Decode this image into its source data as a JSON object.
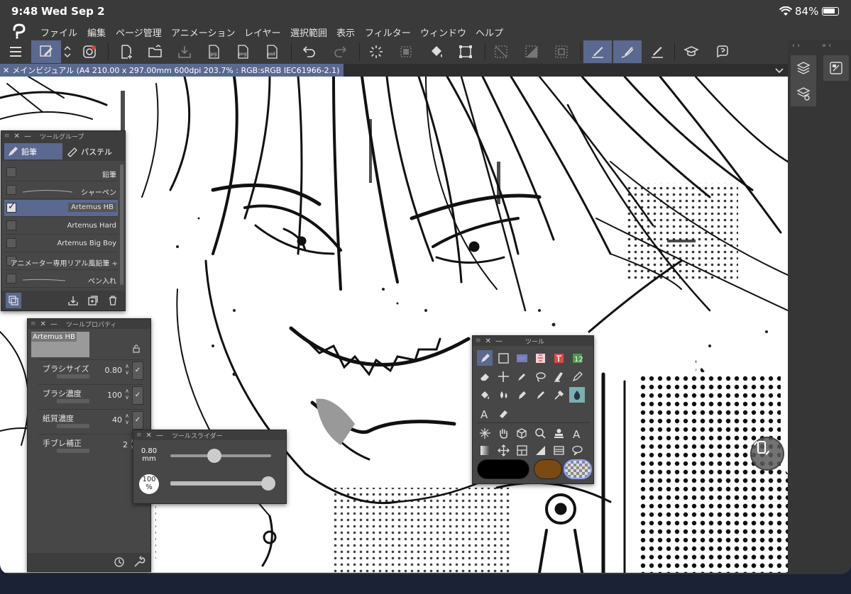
{
  "status": {
    "time": "9:48",
    "date": "Wed Sep 2",
    "battery": "84%"
  },
  "menu": [
    "ファイル",
    "編集",
    "ページ管理",
    "アニメーション",
    "レイヤー",
    "選択範囲",
    "表示",
    "フィルター",
    "ウィンドウ",
    "ヘルプ"
  ],
  "toolbar": {
    "icons": [
      "menu-icon",
      "pen-mode-icon",
      "up-down-icon",
      "companion-icon",
      "new-file-icon",
      "open-folder-icon",
      "save-icon",
      "export-jpg-icon",
      "export-png-icon",
      "export-psd-icon",
      "undo-icon",
      "redo-icon",
      "loading-spinner-icon",
      "layer-fill-icon",
      "bucket-fill-icon",
      "transform-icon",
      "deselect-icon",
      "invert-selection-icon",
      "selection-border-icon",
      "snap-ruler-icon",
      "snap-special-ruler-icon",
      "snap-grid-icon",
      "learn-icon",
      "help-icon"
    ],
    "export_labels": {
      "jpg": "jpg",
      "png": "png",
      "psd": "psd"
    }
  },
  "doc_tab": {
    "close": "✕",
    "title": "メインビジュアル (A4 210.00 x 297.00mm 600dpi 203.7% : RGB:sRGB IEC61966-2.1)"
  },
  "right_dock": {
    "arrows_left": "‹ ›",
    "arrows_right": "» ‹",
    "buttons": [
      "layer-panel-icon",
      "layer-property-icon",
      "navigator-icon"
    ]
  },
  "tool_group": {
    "title": "ツールグループ",
    "tabs": [
      {
        "label": "鉛筆",
        "icon": "pencil-icon",
        "active": true
      },
      {
        "label": "パステル",
        "icon": "pastel-icon",
        "active": false
      }
    ],
    "brushes": [
      {
        "name": "鉛筆",
        "checked": false
      },
      {
        "name": "シャーペン",
        "checked": false
      },
      {
        "name": "Artemus HB",
        "checked": true
      },
      {
        "name": "Artemus Hard",
        "checked": false
      },
      {
        "name": "Artemus Big Boy",
        "checked": false
      },
      {
        "name": "アニメーター専用リアル風鉛筆 ∻",
        "checked": false
      },
      {
        "name": "ペン入れ",
        "checked": false
      }
    ]
  },
  "tool_property": {
    "title": "ツールプロパティ",
    "preset_name": "Artemus HB",
    "props": [
      {
        "label": "ブラシサイズ",
        "value": "0.80"
      },
      {
        "label": "ブラシ濃度",
        "value": "100"
      },
      {
        "label": "紙質濃度",
        "value": "40"
      },
      {
        "label": "手ブレ補正",
        "value": "2"
      }
    ]
  },
  "tool_slider": {
    "title": "ツールスライダー",
    "size_value": "0.80",
    "size_unit": "mm",
    "opacity_value": "100",
    "opacity_unit": "%",
    "size_level": 0.44,
    "opacity_level": 1.0
  },
  "tool_palette": {
    "title": "ツール",
    "rows": [
      [
        "pen-tool-icon",
        "frame-icon",
        "tone-icon",
        "color-blend-icon",
        "text-block-icon",
        "number-icon"
      ],
      [
        "eraser-icon",
        "sparkle-icon",
        "fill-pen-icon",
        "lasso-icon",
        "brush-icon",
        "g-pen-icon"
      ],
      [
        "fill-icon",
        "blend-icon",
        "ink-pen-icon",
        "dropper-pen-icon",
        "eyedropper-icon",
        "water-drop-icon"
      ],
      [
        "text-icon",
        "marker-icon"
      ],
      [
        "magic-wand-icon",
        "hand-icon",
        "cube-icon",
        "zoom-icon",
        "stamp-icon",
        "text-tool-icon"
      ],
      [
        "gradient-icon",
        "move-icon",
        "panel-icon",
        "ruler-icon",
        "figure-icon",
        "speech-balloon-icon"
      ]
    ],
    "colors": {
      "main": "#000000",
      "sub": "#7a4a12",
      "transparent": "checker"
    }
  },
  "theme": {
    "accent": "#5b6990",
    "chrome": "#3a3a3a",
    "panel": "#474747"
  }
}
